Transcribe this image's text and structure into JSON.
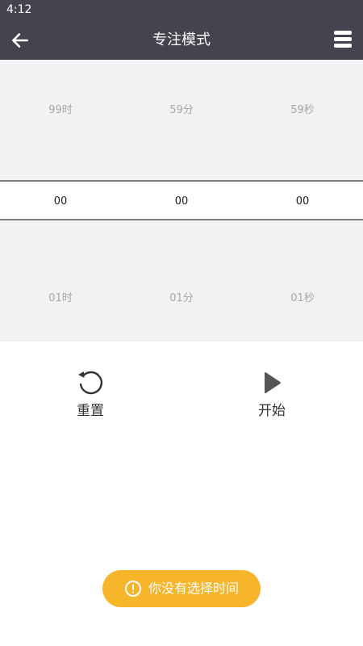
{
  "status_bar": {
    "time": "4:12"
  },
  "app_bar": {
    "title": "专注模式",
    "back_icon": "arrow-left-icon",
    "menu_icon": "hamburger-menu-icon"
  },
  "picker": {
    "hours": {
      "above": "99时",
      "selected": "00",
      "below": "01时"
    },
    "minutes": {
      "above": "59分",
      "selected": "00",
      "below": "01分"
    },
    "seconds": {
      "above": "59秒",
      "selected": "00",
      "below": "01秒"
    }
  },
  "controls": {
    "reset": {
      "label": "重置",
      "icon": "reset-icon"
    },
    "start": {
      "label": "开始",
      "icon": "play-icon"
    }
  },
  "toast": {
    "message": "你没有选择时间",
    "icon": "alert-circle-icon",
    "color": "#f7b52c"
  },
  "colors": {
    "header": "#46434f",
    "picker_background": "#f2f2f4"
  }
}
